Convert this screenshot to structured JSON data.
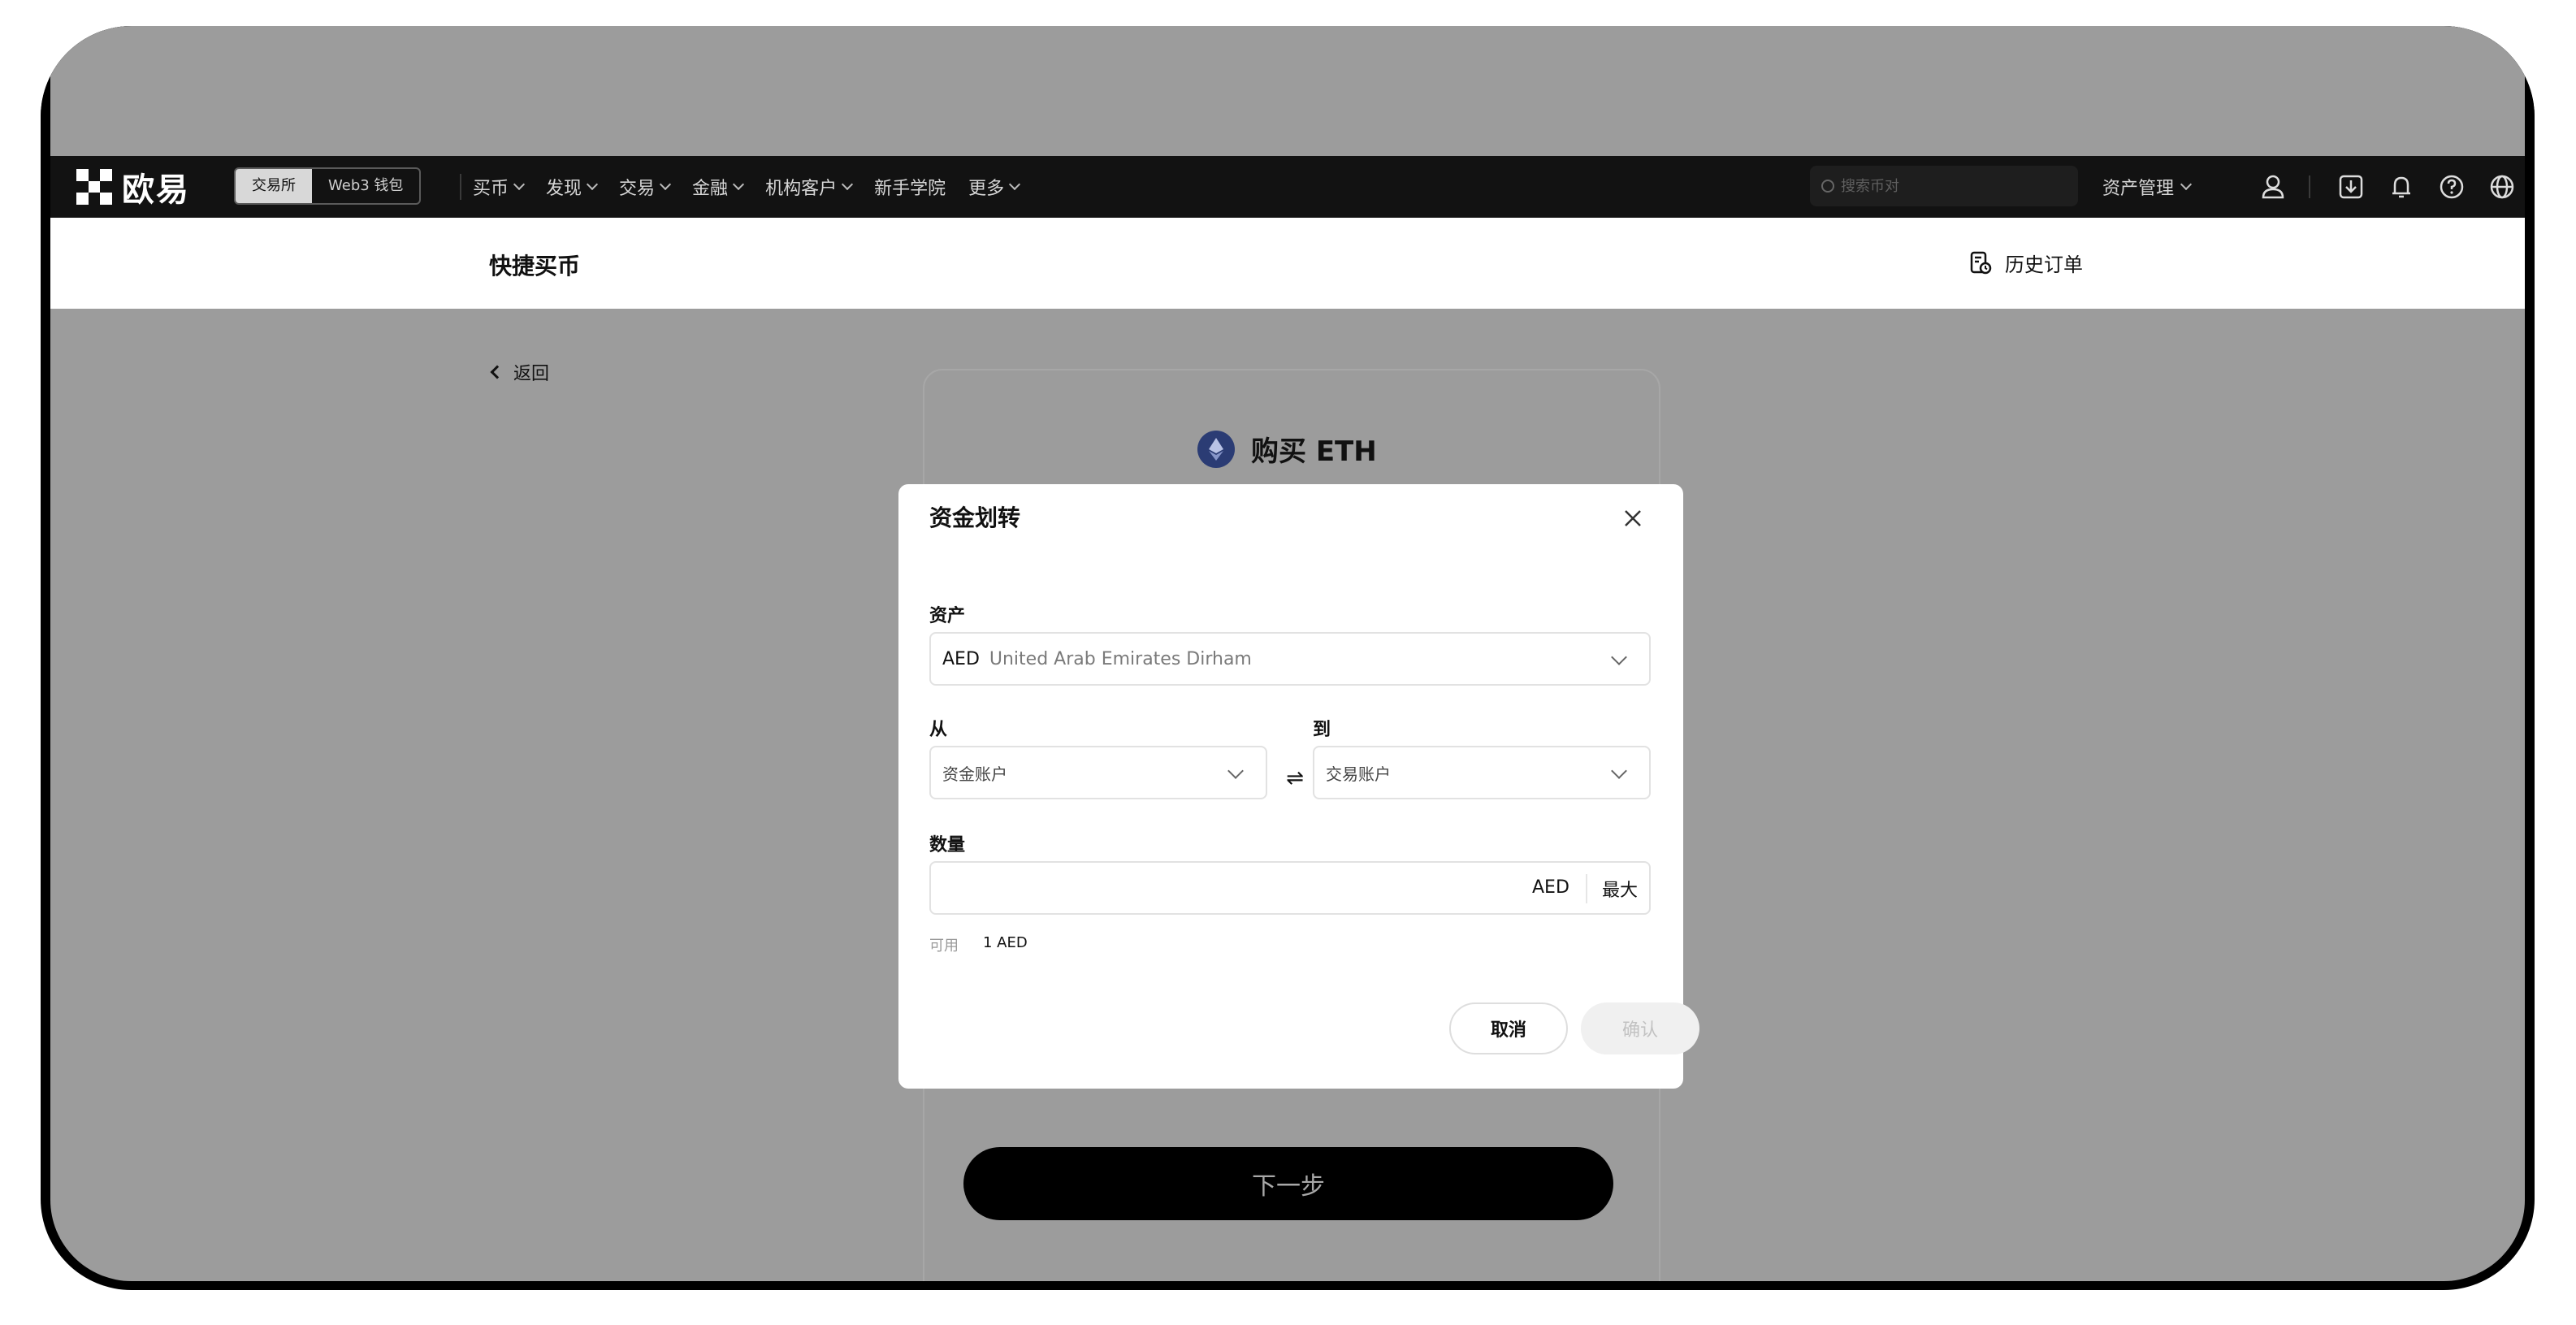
{
  "browser": {
    "traffic_lights": [
      "close",
      "minimize",
      "zoom"
    ]
  },
  "nav": {
    "brand": "欧易",
    "segments": [
      "交易所",
      "Web3 钱包"
    ],
    "menu": [
      {
        "label": "买币",
        "has_dropdown": true
      },
      {
        "label": "发现",
        "has_dropdown": true
      },
      {
        "label": "交易",
        "has_dropdown": true
      },
      {
        "label": "金融",
        "has_dropdown": true
      },
      {
        "label": "机构客户",
        "has_dropdown": true
      },
      {
        "label": "新手学院",
        "has_dropdown": false
      },
      {
        "label": "更多",
        "has_dropdown": true
      }
    ],
    "search_placeholder": "搜索币对",
    "asset_management": "资产管理",
    "icons": [
      "user-icon",
      "download-icon",
      "bell-icon",
      "help-icon",
      "globe-icon"
    ]
  },
  "subheader": {
    "title": "快捷买币",
    "history": "历史订单"
  },
  "page": {
    "back": "返回",
    "buy_title": "购买 ETH",
    "next_button": "下一步"
  },
  "modal": {
    "title": "资金划转",
    "asset_label": "资产",
    "asset_code": "AED",
    "asset_name": "United Arab Emirates Dirham",
    "from_label": "从",
    "from_value": "资金账户",
    "to_label": "到",
    "to_value": "交易账户",
    "swap_symbol": "⇌",
    "amount_label": "数量",
    "amount_value": "",
    "amount_unit": "AED",
    "max_label": "最大",
    "available_label": "可用",
    "available_value": "1 AED",
    "cancel": "取消",
    "confirm": "确认"
  },
  "colors": {
    "overlay": "#9c9c9c",
    "nav_bg": "#121212",
    "eth_icon": "#2b3c74",
    "primary_button": "#000000"
  }
}
